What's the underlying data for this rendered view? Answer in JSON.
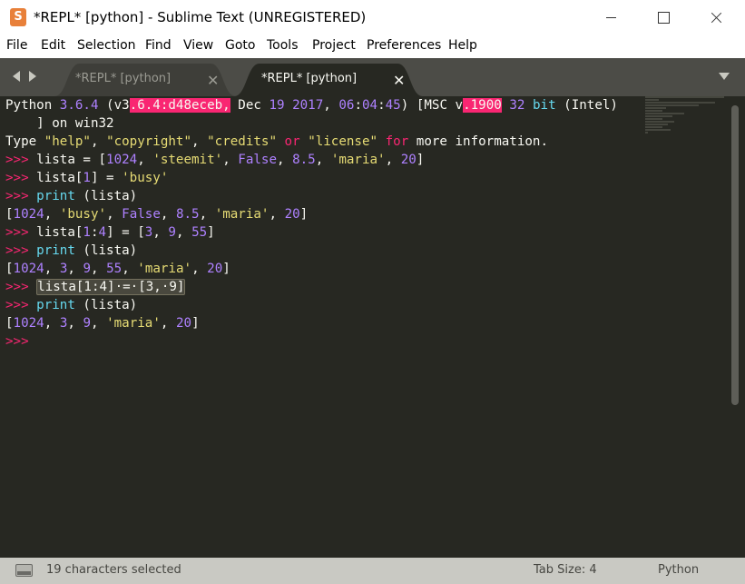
{
  "window": {
    "title": "*REPL* [python] - Sublime Text (UNREGISTERED)",
    "icon_letter": "S"
  },
  "menu": [
    "File",
    "Edit",
    "Selection",
    "Find",
    "View",
    "Goto",
    "Tools",
    "Project",
    "Preferences",
    "Help"
  ],
  "tabs": [
    {
      "label": "*REPL* [python]",
      "active": false,
      "close": "✕"
    },
    {
      "label": "*REPL* [python]",
      "active": true,
      "close": "✕"
    }
  ],
  "editor": {
    "lines": [
      [
        [
          "d",
          "Python "
        ],
        [
          "num",
          "3.6.4"
        ],
        [
          "d",
          " (v3"
        ],
        [
          "err",
          ".6.4:d48eceb,"
        ],
        [
          "d",
          " Dec "
        ],
        [
          "num",
          "19"
        ],
        [
          "d",
          " "
        ],
        [
          "num",
          "2017"
        ],
        [
          "d",
          ", "
        ],
        [
          "num",
          "06"
        ],
        [
          "d",
          ":"
        ],
        [
          "num",
          "04"
        ],
        [
          "d",
          ":"
        ],
        [
          "num",
          "45"
        ],
        [
          "d",
          ") [MSC v"
        ],
        [
          "err",
          ".1900"
        ],
        [
          "d",
          " "
        ],
        [
          "num",
          "32"
        ],
        [
          "d",
          " "
        ],
        [
          "fn",
          "bit"
        ],
        [
          "d",
          " (Intel)"
        ]
      ],
      [
        [
          "d",
          "    ] on win32"
        ]
      ],
      [
        [
          "d",
          "Type "
        ],
        [
          "str",
          "\"help\""
        ],
        [
          "d",
          ", "
        ],
        [
          "str",
          "\"copyright\""
        ],
        [
          "d",
          ", "
        ],
        [
          "str",
          "\"credits\""
        ],
        [
          "d",
          " "
        ],
        [
          "kw",
          "or"
        ],
        [
          "d",
          " "
        ],
        [
          "str",
          "\"license\""
        ],
        [
          "d",
          " "
        ],
        [
          "kw",
          "for"
        ],
        [
          "d",
          " more information."
        ]
      ],
      [
        [
          "prompt",
          ">>>"
        ],
        [
          "d",
          " lista = ["
        ],
        [
          "num",
          "1024"
        ],
        [
          "d",
          ", "
        ],
        [
          "str",
          "'steemit'"
        ],
        [
          "d",
          ", "
        ],
        [
          "num",
          "False"
        ],
        [
          "d",
          ", "
        ],
        [
          "num",
          "8.5"
        ],
        [
          "d",
          ", "
        ],
        [
          "str",
          "'maria'"
        ],
        [
          "d",
          ", "
        ],
        [
          "num",
          "20"
        ],
        [
          "d",
          "]"
        ]
      ],
      [
        [
          "prompt",
          ">>>"
        ],
        [
          "d",
          " lista["
        ],
        [
          "num",
          "1"
        ],
        [
          "d",
          "] = "
        ],
        [
          "str",
          "'busy'"
        ]
      ],
      [
        [
          "prompt",
          ">>>"
        ],
        [
          "d",
          " "
        ],
        [
          "fn",
          "print"
        ],
        [
          "d",
          " (lista)"
        ]
      ],
      [
        [
          "d",
          "["
        ],
        [
          "num",
          "1024"
        ],
        [
          "d",
          ", "
        ],
        [
          "str",
          "'busy'"
        ],
        [
          "d",
          ", "
        ],
        [
          "num",
          "False"
        ],
        [
          "d",
          ", "
        ],
        [
          "num",
          "8.5"
        ],
        [
          "d",
          ", "
        ],
        [
          "str",
          "'maria'"
        ],
        [
          "d",
          ", "
        ],
        [
          "num",
          "20"
        ],
        [
          "d",
          "]"
        ]
      ],
      [
        [
          "prompt",
          ">>>"
        ],
        [
          "d",
          " lista["
        ],
        [
          "num",
          "1"
        ],
        [
          "d",
          ":"
        ],
        [
          "num",
          "4"
        ],
        [
          "d",
          "] = ["
        ],
        [
          "num",
          "3"
        ],
        [
          "d",
          ", "
        ],
        [
          "num",
          "9"
        ],
        [
          "d",
          ", "
        ],
        [
          "num",
          "55"
        ],
        [
          "d",
          "]"
        ]
      ],
      [
        [
          "prompt",
          ">>>"
        ],
        [
          "d",
          " "
        ],
        [
          "fn",
          "print"
        ],
        [
          "d",
          " (lista)"
        ]
      ],
      [
        [
          "d",
          "["
        ],
        [
          "num",
          "1024"
        ],
        [
          "d",
          ", "
        ],
        [
          "num",
          "3"
        ],
        [
          "d",
          ", "
        ],
        [
          "num",
          "9"
        ],
        [
          "d",
          ", "
        ],
        [
          "num",
          "55"
        ],
        [
          "d",
          ", "
        ],
        [
          "str",
          "'maria'"
        ],
        [
          "d",
          ", "
        ],
        [
          "num",
          "20"
        ],
        [
          "d",
          "]"
        ]
      ],
      [
        [
          "prompt",
          ">>>"
        ],
        [
          "d",
          " "
        ],
        [
          "sel",
          "lista[1:4]·=·[3,·9]"
        ]
      ],
      [
        [
          "prompt",
          ">>>"
        ],
        [
          "d",
          " "
        ],
        [
          "fn",
          "print"
        ],
        [
          "d",
          " (lista)"
        ]
      ],
      [
        [
          "d",
          "["
        ],
        [
          "num",
          "1024"
        ],
        [
          "d",
          ", "
        ],
        [
          "num",
          "3"
        ],
        [
          "d",
          ", "
        ],
        [
          "num",
          "9"
        ],
        [
          "d",
          ", "
        ],
        [
          "str",
          "'maria'"
        ],
        [
          "d",
          ", "
        ],
        [
          "num",
          "20"
        ],
        [
          "d",
          "]"
        ]
      ],
      [
        [
          "prompt",
          ">>>"
        ]
      ]
    ]
  },
  "status": {
    "selection": "19 characters selected",
    "tab_size": "Tab Size: 4",
    "syntax": "Python"
  },
  "colors": {
    "editor_bg": "#272822",
    "tabbar_bg": "#4c4c47",
    "active_tab_bg": "#272822",
    "inactive_tab_bg": "#3e3e39",
    "statusbar_bg": "#c9c9c3",
    "keyword": "#f92672",
    "number": "#ae81ff",
    "string": "#e6db74",
    "builtin": "#66d9ef",
    "text": "#f8f8f2"
  },
  "icons": {
    "nav_left": "chevron-left-icon",
    "nav_right": "chevron-right-icon",
    "tab_dropdown": "chevron-down-icon",
    "panel": "panel-toggle-icon"
  }
}
